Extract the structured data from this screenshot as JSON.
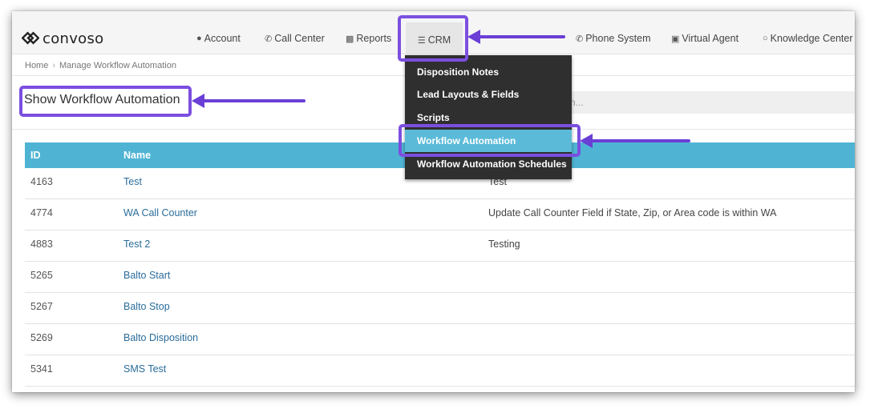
{
  "brand": {
    "name": "convoso"
  },
  "nav": {
    "items": [
      {
        "label": "Account",
        "icon": "user-icon"
      },
      {
        "label": "Call Center",
        "icon": "phone-icon"
      },
      {
        "label": "Reports",
        "icon": "bar-chart-icon"
      },
      {
        "label": "CRM",
        "icon": "list-icon"
      },
      {
        "label": "Phone System",
        "icon": "phone-icon"
      },
      {
        "label": "Virtual Agent",
        "icon": "monitor-icon"
      },
      {
        "label": "Knowledge Center",
        "icon": "lightbulb-icon"
      }
    ]
  },
  "breadcrumb": {
    "home": "Home",
    "current": "Manage Workflow Automation"
  },
  "page": {
    "title": "Show Workflow Automation",
    "search_placeholder": "n..."
  },
  "dropdown": {
    "items": [
      {
        "label": "Disposition Notes"
      },
      {
        "label": "Lead Layouts & Fields"
      },
      {
        "label": "Scripts"
      },
      {
        "label": "Workflow Automation",
        "active": true
      },
      {
        "label": "Workflow Automation Schedules"
      }
    ]
  },
  "table": {
    "headers": {
      "id": "ID",
      "name": "Name"
    },
    "rows": [
      {
        "id": "4163",
        "name": "Test",
        "description": "Test"
      },
      {
        "id": "4774",
        "name": "WA Call Counter",
        "description": "Update Call Counter Field if State, Zip, or Area code is within WA"
      },
      {
        "id": "4883",
        "name": "Test 2",
        "description": "Testing"
      },
      {
        "id": "5265",
        "name": "Balto Start",
        "description": ""
      },
      {
        "id": "5267",
        "name": "Balto Stop",
        "description": ""
      },
      {
        "id": "5269",
        "name": "Balto Disposition",
        "description": ""
      },
      {
        "id": "5341",
        "name": "SMS Test",
        "description": ""
      }
    ]
  },
  "colors": {
    "highlight": "#7b4fe0",
    "header": "#4fb4d3",
    "link": "#2a6c9a",
    "dropdown_bg": "#2f2f2f"
  }
}
